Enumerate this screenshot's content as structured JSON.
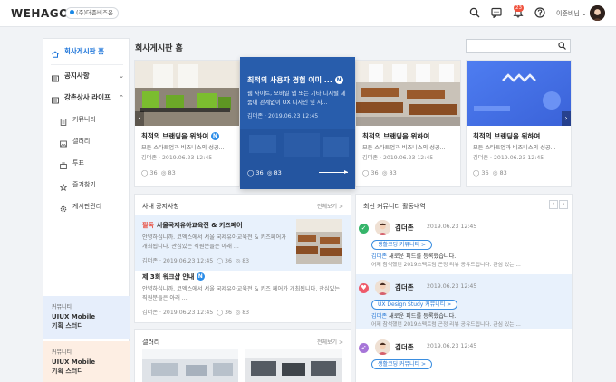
{
  "header": {
    "logo": "WEHAGO",
    "company": "(주)더존비즈온",
    "notification_count": "23",
    "username": "이준비님"
  },
  "icons": {
    "search": "search-icon",
    "messenger": "chat-icon",
    "note": "note-icon",
    "bell": "bell-icon",
    "help": "help-icon"
  },
  "sidebar": {
    "home": "회사게시판 홈",
    "notice": "공지사항",
    "club": "강촌상사 라이프",
    "items": [
      "커뮤니티",
      "갤러리",
      "투표",
      "즐겨찾기",
      "게시판관리"
    ],
    "promos": [
      {
        "small": "커뮤니티",
        "big1": "UIUX Mobile",
        "big2": "기획 스터디"
      },
      {
        "small": "커뮤니티",
        "big1": "UIUX Mobile",
        "big2": "기획 스터디"
      }
    ]
  },
  "main": {
    "title": "회사게시판 홈",
    "search_placeholder": ""
  },
  "cards": [
    {
      "title": "최적의 브랜딩을 위하여",
      "badge": "N",
      "desc": "모든 스타트업과 비즈니스의 성공...",
      "meta": "김더존 · 2019.06.23 12:45",
      "comments": "36",
      "views": "83"
    },
    {
      "title": "최적의 브랜딩을 위하여",
      "badge": "N",
      "desc": "모든 스타트업과 비즈니스의 성공...",
      "meta": "김더존 · 2019.06.23 12:45",
      "comments": "36",
      "views": "83"
    },
    {
      "title": "최적의 브랜딩을 위하여",
      "badge": "N",
      "desc": "모든 스타트업과 비즈니스의 성공...",
      "meta": "김더존 · 2019.06.23 12:45",
      "comments": "36",
      "views": "83"
    }
  ],
  "feature": {
    "title": "최적의 사용자 경험 이미 ...",
    "badge": "N",
    "desc": "웹 사이트, 모바일 앱 또는 기타 디지털 제품에 관계없이 UX 디자인 및 사...",
    "meta": "김더존 · 2019.06.23 12:45",
    "comments": "36",
    "views": "83"
  },
  "notice_panel": {
    "title": "사내 공지사항",
    "more": "전체보기 >",
    "items": [
      {
        "tag": "필독",
        "title": "서울국제유아교육전 & 키즈페어",
        "body": "안녕하십니까. 코엑스에서 서울 국제유아교육전 & 키즈페어가 개최됩니다. 관심있는 직원분들은 아래 ...",
        "meta": "김더존 · 2019.06.23 12:45",
        "comments": "36",
        "views": "83"
      },
      {
        "title": "제 3회 워크샵 안내",
        "badge": "N",
        "body": "안녕하십니까. 코엑스에서 서울 국제유아교육전 & 키즈 페어가 개최됩니다. 관심있는 직원분들은 아래 ...",
        "meta": "김더존 · 2019.06.23 12:45",
        "comments": "36",
        "views": "83"
      }
    ]
  },
  "activity_panel": {
    "title": "최신 커뮤니티 활동내역",
    "items": [
      {
        "name": "김더존",
        "date": "2019.06.23 12:45",
        "chip": "생활코딩 커뮤니티 >",
        "line_name": "김더존",
        "line": " 새로운 피드를 등록했습니다.",
        "sub": "어제 참석했던 2019스펙트럼 곤정 리뷰 공유드립니다. 관심 있는 ...",
        "mark": "✓",
        "mark_color": "#35b56a"
      },
      {
        "name": "김더존",
        "date": "2019.06.23 12:45",
        "chip": "UX Design Study 커뮤니티 >",
        "line_name": "김더존",
        "line": " 새로운 피드를 등록했습니다.",
        "sub": "어제 참석했던 2019스펙트럼 곤정 리뷰 공유드립니다. 관심 있는 ...",
        "mark": "♥",
        "mark_color": "#ef5a6a"
      },
      {
        "name": "김더존",
        "date": "2019.06.23 12:45",
        "chip": "생활코딩 커뮤니티 >",
        "mark": "➶",
        "mark_color": "#a675d8"
      }
    ]
  },
  "gallery_panel": {
    "title": "갤러리",
    "more": "전체보기 >"
  }
}
